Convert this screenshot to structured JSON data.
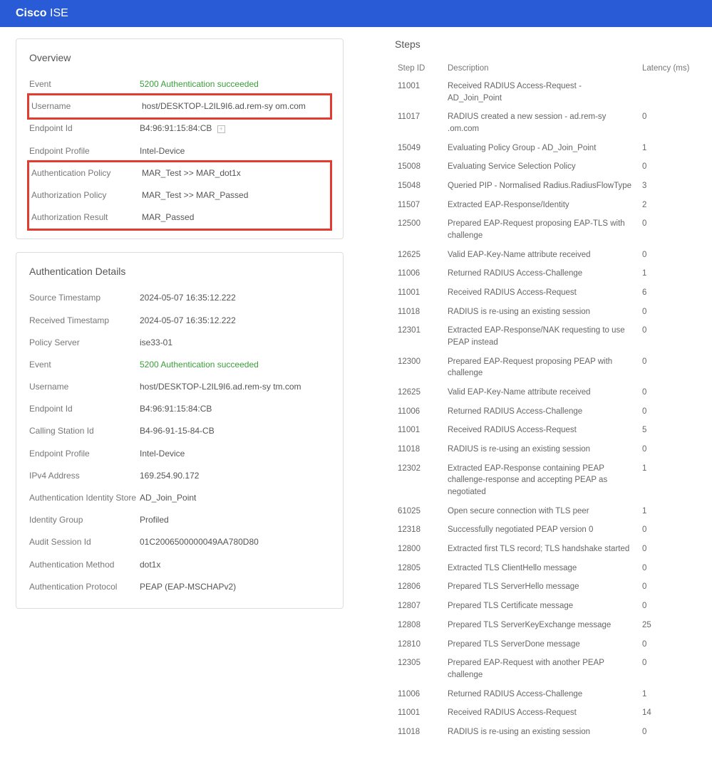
{
  "brand": {
    "bold": "Cisco",
    "light": "ISE"
  },
  "overview": {
    "title": "Overview",
    "event_label": "Event",
    "event_value": "5200 Authentication succeeded",
    "username_label": "Username",
    "username_value": "host/DESKTOP-L2IL9I6.ad.rem-sy  om.com",
    "endpoint_id_label": "Endpoint Id",
    "endpoint_id_value": "B4:96:91:15:84:CB",
    "endpoint_profile_label": "Endpoint Profile",
    "endpoint_profile_value": "Intel-Device",
    "auth_policy_label": "Authentication Policy",
    "auth_policy_value": "MAR_Test >> MAR_dot1x",
    "authz_policy_label": "Authorization Policy",
    "authz_policy_value": "MAR_Test >> MAR_Passed",
    "authz_result_label": "Authorization Result",
    "authz_result_value": "MAR_Passed"
  },
  "details": {
    "title": "Authentication Details",
    "rows": [
      {
        "label": "Source Timestamp",
        "value": "2024-05-07 16:35:12.222"
      },
      {
        "label": "Received Timestamp",
        "value": "2024-05-07 16:35:12.222"
      },
      {
        "label": "Policy Server",
        "value": "ise33-01"
      },
      {
        "label": "Event",
        "value": "5200 Authentication succeeded",
        "green": true
      },
      {
        "label": "Username",
        "value": "host/DESKTOP-L2IL9I6.ad.rem-sy  tm.com"
      },
      {
        "label": "Endpoint Id",
        "value": "B4:96:91:15:84:CB"
      },
      {
        "label": "Calling Station Id",
        "value": "B4-96-91-15-84-CB"
      },
      {
        "label": "Endpoint Profile",
        "value": "Intel-Device"
      },
      {
        "label": "IPv4 Address",
        "value": "169.254.90.172"
      },
      {
        "label": "Authentication Identity Store",
        "value": "AD_Join_Point"
      },
      {
        "label": "Identity Group",
        "value": "Profiled"
      },
      {
        "label": "Audit Session Id",
        "value": "01C2006500000049AA780D80"
      },
      {
        "label": "Authentication Method",
        "value": "dot1x"
      },
      {
        "label": "Authentication Protocol",
        "value": "PEAP (EAP-MSCHAPv2)"
      }
    ]
  },
  "steps": {
    "title": "Steps",
    "headers": {
      "stepid": "Step ID",
      "desc": "Description",
      "latency": "Latency (ms)"
    },
    "rows": [
      {
        "id": "11001",
        "desc": "Received RADIUS Access-Request - AD_Join_Point",
        "lat": ""
      },
      {
        "id": "11017",
        "desc": "RADIUS created a new session - ad.rem-sy  .om.com",
        "lat": "0"
      },
      {
        "id": "15049",
        "desc": "Evaluating Policy Group - AD_Join_Point",
        "lat": "1"
      },
      {
        "id": "15008",
        "desc": "Evaluating Service Selection Policy",
        "lat": "0"
      },
      {
        "id": "15048",
        "desc": "Queried PIP - Normalised Radius.RadiusFlowType",
        "lat": "3"
      },
      {
        "id": "11507",
        "desc": "Extracted EAP-Response/Identity",
        "lat": "2"
      },
      {
        "id": "12500",
        "desc": "Prepared EAP-Request proposing EAP-TLS with challenge",
        "lat": "0"
      },
      {
        "id": "12625",
        "desc": "Valid EAP-Key-Name attribute received",
        "lat": "0"
      },
      {
        "id": "11006",
        "desc": "Returned RADIUS Access-Challenge",
        "lat": "1"
      },
      {
        "id": "11001",
        "desc": "Received RADIUS Access-Request",
        "lat": "6"
      },
      {
        "id": "11018",
        "desc": "RADIUS is re-using an existing session",
        "lat": "0"
      },
      {
        "id": "12301",
        "desc": "Extracted EAP-Response/NAK requesting to use PEAP instead",
        "lat": "0"
      },
      {
        "id": "12300",
        "desc": "Prepared EAP-Request proposing PEAP with challenge",
        "lat": "0"
      },
      {
        "id": "12625",
        "desc": "Valid EAP-Key-Name attribute received",
        "lat": "0"
      },
      {
        "id": "11006",
        "desc": "Returned RADIUS Access-Challenge",
        "lat": "0"
      },
      {
        "id": "11001",
        "desc": "Received RADIUS Access-Request",
        "lat": "5"
      },
      {
        "id": "11018",
        "desc": "RADIUS is re-using an existing session",
        "lat": "0"
      },
      {
        "id": "12302",
        "desc": "Extracted EAP-Response containing PEAP challenge-response and accepting PEAP as negotiated",
        "lat": "1"
      },
      {
        "id": "61025",
        "desc": "Open secure connection with TLS peer",
        "lat": "1"
      },
      {
        "id": "12318",
        "desc": "Successfully negotiated PEAP version 0",
        "lat": "0"
      },
      {
        "id": "12800",
        "desc": "Extracted first TLS record; TLS handshake started",
        "lat": "0"
      },
      {
        "id": "12805",
        "desc": "Extracted TLS ClientHello message",
        "lat": "0"
      },
      {
        "id": "12806",
        "desc": "Prepared TLS ServerHello message",
        "lat": "0"
      },
      {
        "id": "12807",
        "desc": "Prepared TLS Certificate message",
        "lat": "0"
      },
      {
        "id": "12808",
        "desc": "Prepared TLS ServerKeyExchange message",
        "lat": "25"
      },
      {
        "id": "12810",
        "desc": "Prepared TLS ServerDone message",
        "lat": "0"
      },
      {
        "id": "12305",
        "desc": "Prepared EAP-Request with another PEAP challenge",
        "lat": "0"
      },
      {
        "id": "11006",
        "desc": "Returned RADIUS Access-Challenge",
        "lat": "1"
      },
      {
        "id": "11001",
        "desc": "Received RADIUS Access-Request",
        "lat": "14"
      },
      {
        "id": "11018",
        "desc": "RADIUS is re-using an existing session",
        "lat": "0"
      }
    ]
  }
}
